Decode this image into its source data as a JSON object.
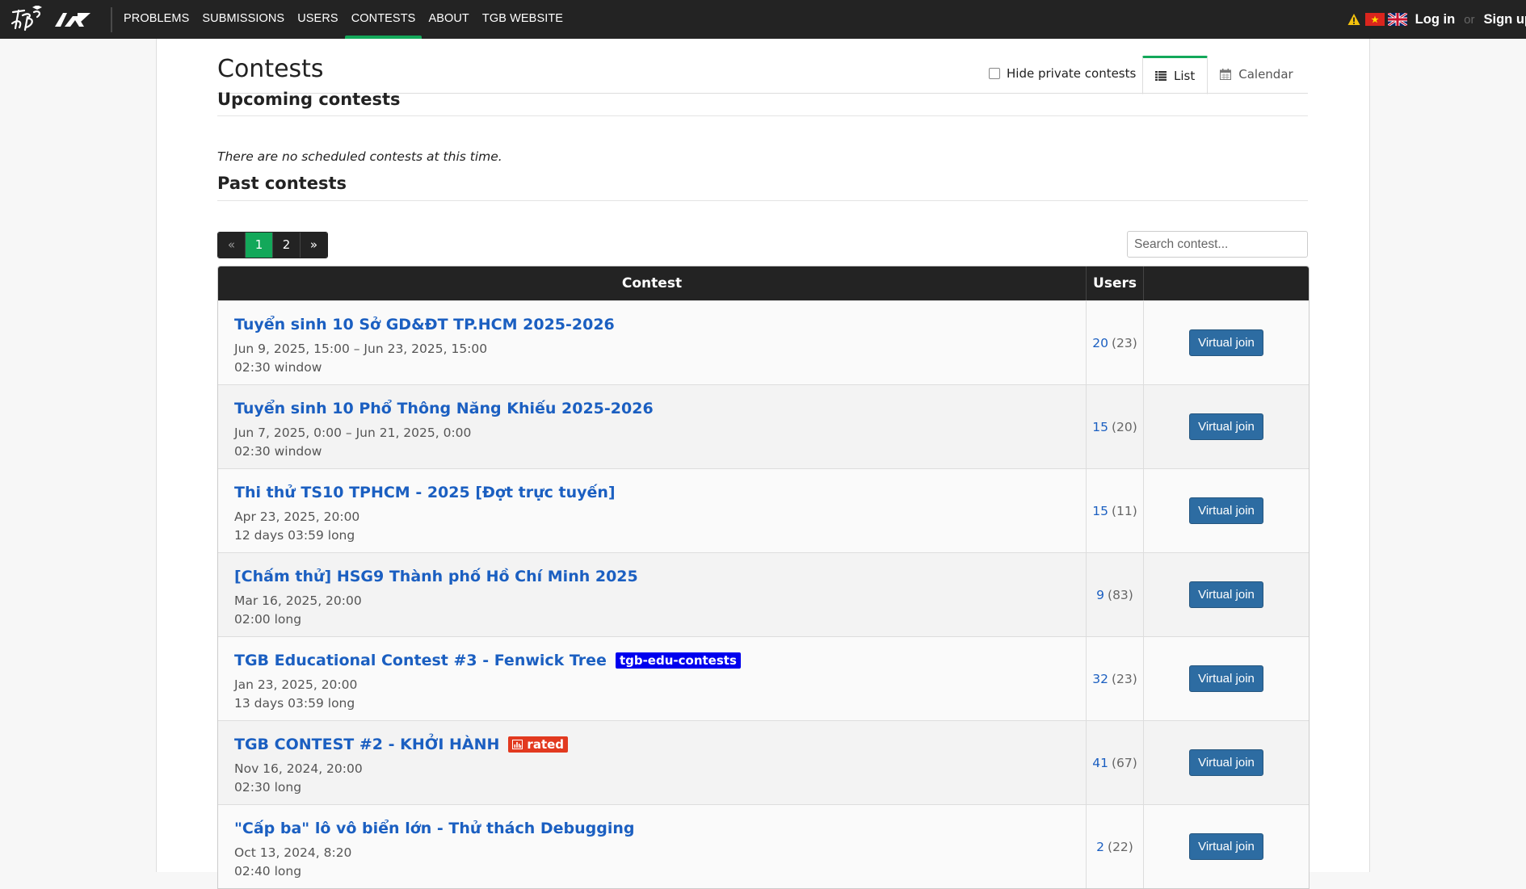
{
  "nav": {
    "items": [
      {
        "label": "PROBLEMS",
        "active": false
      },
      {
        "label": "SUBMISSIONS",
        "active": false
      },
      {
        "label": "USERS",
        "active": false
      },
      {
        "label": "CONTESTS",
        "active": true
      },
      {
        "label": "ABOUT",
        "active": false
      },
      {
        "label": "TGB WEBSITE",
        "active": false
      }
    ],
    "login": "Log in",
    "or": "or",
    "signup": "Sign up",
    "icons": [
      "warning-icon",
      "vietnam-flag-icon",
      "uk-flag-icon"
    ]
  },
  "page": {
    "title": "Contests",
    "hide_private_label": "Hide private contests",
    "hide_private_checked": false,
    "view_tabs": [
      {
        "label": "List",
        "icon": "list-icon",
        "active": true
      },
      {
        "label": "Calendar",
        "icon": "calendar-icon",
        "active": false
      }
    ]
  },
  "upcoming": {
    "title": "Upcoming contests",
    "empty_message": "There are no scheduled contests at this time."
  },
  "past": {
    "title": "Past contests",
    "pagination": {
      "prev": "«",
      "pages": [
        "1",
        "2"
      ],
      "current": "1",
      "next": "»"
    },
    "search_placeholder": "Search contest...",
    "columns": {
      "contest": "Contest",
      "users": "Users",
      "action": ""
    },
    "rows": [
      {
        "name": "Tuyển sinh 10 Sở GD&ĐT TP.HCM 2025-2026",
        "tag": "",
        "time": "Jun 9, 2025, 15:00 – Jun 23, 2025, 15:00",
        "duration": "02:30 window",
        "users": "20",
        "total": "(23)",
        "action": "Virtual join"
      },
      {
        "name": "Tuyển sinh 10 Phổ Thông Năng Khiếu 2025-2026",
        "tag": "",
        "time": "Jun 7, 2025, 0:00 – Jun 21, 2025, 0:00",
        "duration": "02:30 window",
        "users": "15",
        "total": "(20)",
        "action": "Virtual join"
      },
      {
        "name": "Thi thử TS10 TPHCM - 2025 [Đợt trực tuyến]",
        "tag": "",
        "time": "Apr 23, 2025, 20:00",
        "duration": "12 days 03:59 long",
        "users": "15",
        "total": "(11)",
        "action": "Virtual join"
      },
      {
        "name": "[Chấm thử] HSG9 Thành phố Hồ Chí Minh 2025",
        "tag": "",
        "time": "Mar 16, 2025, 20:00",
        "duration": "02:00 long",
        "users": "9",
        "total": "(83)",
        "action": "Virtual join"
      },
      {
        "name": "TGB Educational Contest #3 - Fenwick Tree",
        "tag": "tgb-edu-contests",
        "tag_style": "blue",
        "time": "Jan 23, 2025, 20:00",
        "duration": "13 days 03:59 long",
        "users": "32",
        "total": "(23)",
        "action": "Virtual join"
      },
      {
        "name": "TGB CONTEST #2 - KHỞI HÀNH",
        "tag": "rated",
        "tag_style": "red",
        "tag_icon": "bar-chart-icon",
        "time": "Nov 16, 2024, 20:00",
        "duration": "02:30 long",
        "users": "41",
        "total": "(67)",
        "action": "Virtual join"
      },
      {
        "name": "\"Cấp ba\" lô vô biển lớn - Thử thách Debugging",
        "tag": "",
        "time": "Oct 13, 2024, 8:20",
        "duration": "02:40 long",
        "users": "2",
        "total": "(22)",
        "action": "Virtual join"
      }
    ]
  },
  "colors": {
    "navbar_bg": "#232323",
    "accent_green": "#13a85a",
    "link_blue": "#1b5fc1",
    "button_blue": "#2d6ca2",
    "tag_blue": "#0000ee",
    "tag_red": "#e2391f"
  }
}
